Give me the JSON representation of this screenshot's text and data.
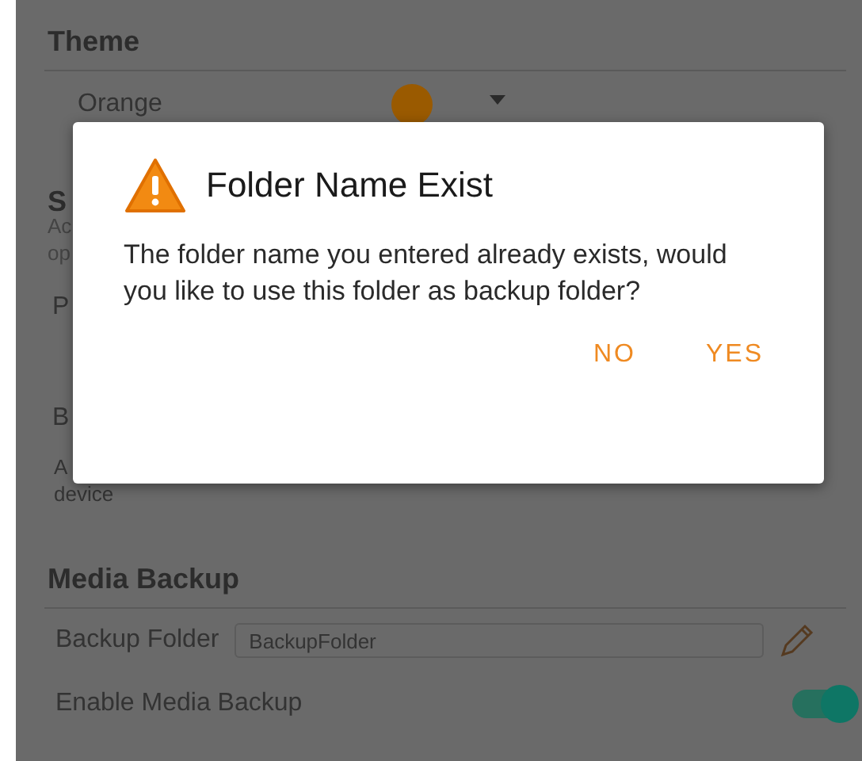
{
  "theme": {
    "title": "Theme",
    "value": "Orange"
  },
  "hidden_section": {
    "title": "S",
    "description_lines": [
      "Ac",
      "op"
    ],
    "rows": [
      {
        "label": "P"
      },
      {
        "label": "B",
        "description_lines": [
          "A",
          "device"
        ]
      }
    ]
  },
  "media_backup": {
    "title": "Media Backup",
    "backup_folder": {
      "label": "Backup Folder",
      "value": "BackupFolder"
    },
    "enable": {
      "label": "Enable Media Backup",
      "on": true
    }
  },
  "dialog": {
    "title": "Folder Name Exist",
    "message": "The folder name you entered already exists, would you like to use this folder as backup folder?",
    "buttons": [
      "NO",
      "YES"
    ]
  }
}
